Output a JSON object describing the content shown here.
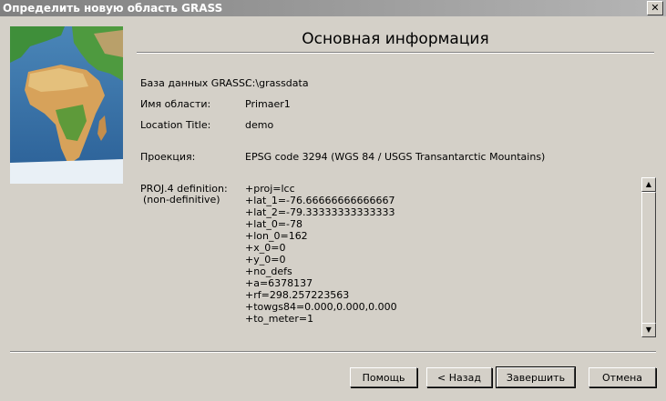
{
  "window": {
    "title": "Определить новую область GRASS",
    "close_glyph": "✕"
  },
  "page": {
    "heading": "Основная информация"
  },
  "fields": [
    {
      "label": "База данных GRASS:",
      "value": "C:\\grassdata"
    },
    {
      "label": "Имя области:",
      "value": "Primaer1"
    },
    {
      "label": "Location Title:",
      "value": "demo"
    },
    {
      "label": "Проекция:",
      "value": "EPSG code 3294 (WGS 84 / USGS Transantarctic Mountains)"
    }
  ],
  "proj4": {
    "label_line1": "PROJ.4 definition:",
    "label_line2": "(non-definitive)",
    "lines": [
      "+proj=lcc",
      "+lat_1=-76.66666666666667",
      "+lat_2=-79.33333333333333",
      "+lat_0=-78",
      "+lon_0=162",
      "+x_0=0",
      "+y_0=0",
      "+no_defs",
      "+a=6378137",
      "+rf=298.257223563",
      "+towgs84=0.000,0.000,0.000",
      "+to_meter=1"
    ]
  },
  "buttons": {
    "help": "Помощь",
    "back": "< Назад",
    "finish": "Завершить",
    "cancel": "Отмена"
  },
  "icons": {
    "map": "world-map-image",
    "scroll_up": "arrow-up-icon",
    "scroll_down": "arrow-down-icon",
    "close": "close-icon"
  },
  "colors": {
    "titlebar_start": "#808080",
    "titlebar_end": "#b5b5b5",
    "dialog_bg": "#d4d0c8"
  }
}
